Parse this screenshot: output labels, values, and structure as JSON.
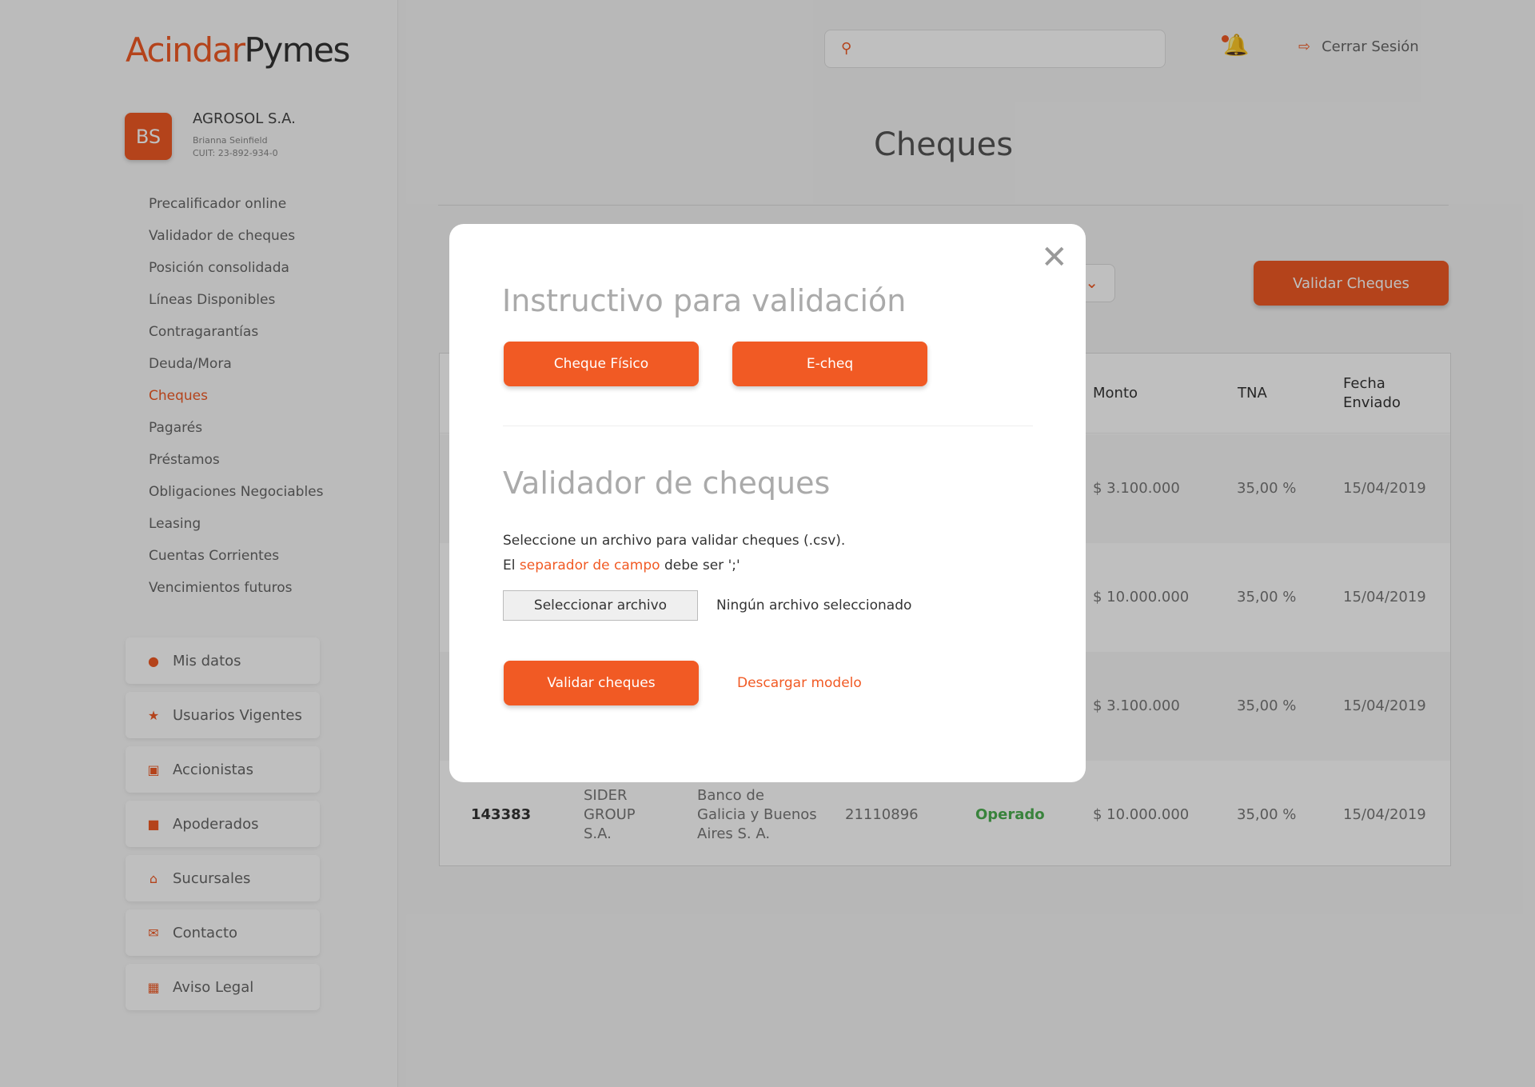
{
  "logo": {
    "part1": "Acindar",
    "part2": "Pymes"
  },
  "profile": {
    "initials": "BS",
    "company": "AGROSOL S.A.",
    "name": "Brianna Seinfield",
    "cuit": "CUIT: 23-892-934-0"
  },
  "nav": [
    "Precalificador online",
    "Validador de cheques",
    "Posición consolidada",
    "Líneas Disponibles",
    "Contragarantías",
    "Deuda/Mora",
    "Cheques",
    "Pagarés",
    "Préstamos",
    "Obligaciones Negociables",
    "Leasing",
    "Cuentas Corrientes",
    "Vencimientos futuros"
  ],
  "nav_active": "Cheques",
  "side_cards": [
    {
      "label": "Mis datos",
      "icon": "user-icon"
    },
    {
      "label": "Usuarios Vigentes",
      "icon": "star-icon"
    },
    {
      "label": "Accionistas",
      "icon": "chart-icon"
    },
    {
      "label": "Apoderados",
      "icon": "badge-icon"
    },
    {
      "label": "Sucursales",
      "icon": "home-icon"
    },
    {
      "label": "Contacto",
      "icon": "mail-icon"
    },
    {
      "label": "Aviso Legal",
      "icon": "grid-icon"
    }
  ],
  "header": {
    "search_placeholder": "",
    "logout": "Cerrar Sesión"
  },
  "page": {
    "title": "Cheques",
    "validate_button": "Validar Cheques"
  },
  "table": {
    "headers": [
      "Monto",
      "TNA",
      "Fecha Enviado"
    ],
    "rows": [
      {
        "monto": "$ 3.100.000",
        "tna": "35,00 %",
        "fecha": "15/04/2019"
      },
      {
        "monto": "$ 10.000.000",
        "tna": "35,00 %",
        "fecha": "15/04/2019"
      },
      {
        "monto": "$ 3.100.000",
        "tna": "35,00 %",
        "fecha": "15/04/2019"
      },
      {
        "id": "143383",
        "empresa": "SIDER GROUP S.A.",
        "banco": "Banco de Galicia y Buenos Aires S. A.",
        "numero": "21110896",
        "estado": "Operado",
        "monto": "$ 10.000.000",
        "tna": "35,00 %",
        "fecha": "15/04/2019"
      }
    ]
  },
  "modal": {
    "title1": "Instructivo para validación",
    "btn_fisico": "Cheque Físico",
    "btn_echeq": "E-cheq",
    "title2": "Validador de cheques",
    "text1": "Seleccione un archivo para validar cheques (.csv).",
    "text2_pre": "El ",
    "text2_link": "separador de campo",
    "text2_post": " debe ser ';'",
    "file_button": "Seleccionar archivo",
    "file_none": "Ningún archivo seleccionado",
    "validate": "Validar cheques",
    "download": "Descargar modelo"
  },
  "colors": {
    "accent": "#f15a24",
    "ok": "#4caf50"
  }
}
